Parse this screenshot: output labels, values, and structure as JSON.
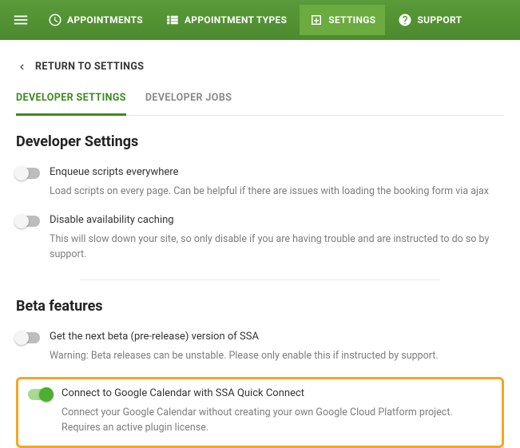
{
  "topnav": {
    "items": [
      {
        "label": "APPOINTMENTS"
      },
      {
        "label": "APPOINTMENT TYPES"
      },
      {
        "label": "SETTINGS"
      },
      {
        "label": "SUPPORT"
      }
    ]
  },
  "back_label": "RETURN TO SETTINGS",
  "tabs": {
    "developer_settings": "DEVELOPER SETTINGS",
    "developer_jobs": "DEVELOPER JOBS"
  },
  "sections": {
    "dev_settings_title": "Developer Settings",
    "beta_title": "Beta features"
  },
  "settings": {
    "enqueue": {
      "label": "Enqueue scripts everywhere",
      "desc": "Load scripts on every page. Can be helpful if there are issues with loading the booking form via ajax",
      "on": false
    },
    "disable_cache": {
      "label": "Disable availability caching",
      "desc": "This will slow down your site, so only disable if you are having trouble and are instructed to do so by support.",
      "on": false
    },
    "beta_next": {
      "label": "Get the next beta (pre-release) version of SSA",
      "desc": "Warning: Beta releases can be unstable. Please only enable this if instructed by support.",
      "on": false
    },
    "quick_connect": {
      "label": "Connect to Google Calendar with SSA Quick Connect",
      "desc": "Connect your Google Calendar without creating your own Google Cloud Platform project. Requires an active plugin license.",
      "on": true
    }
  }
}
